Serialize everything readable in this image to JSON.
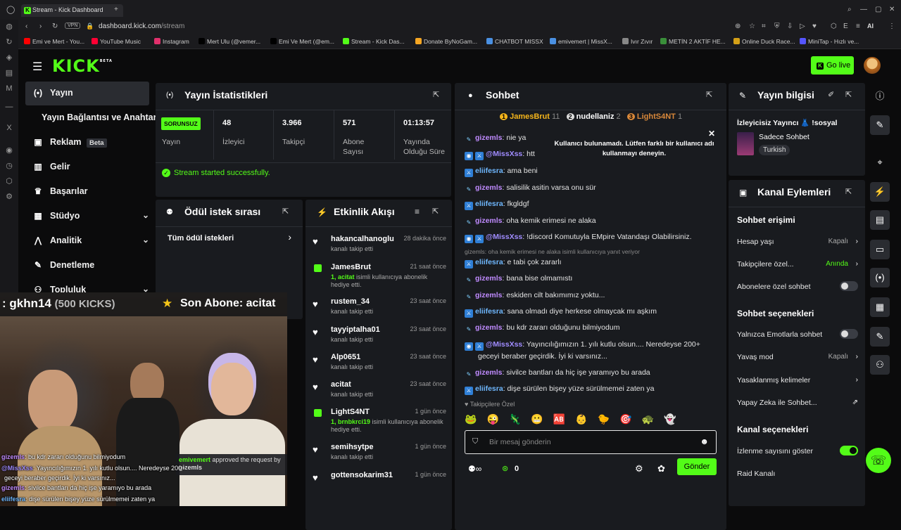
{
  "browser": {
    "tab_title": "Stream - Kick Dashboard",
    "url_domain": "dashboard.kick.com",
    "url_path": "/stream",
    "vpn_label": "VPN",
    "ai_label": "AI",
    "bookmarks": [
      {
        "label": "Emi ve Mert - You...",
        "color": "#ff0000"
      },
      {
        "label": "YouTube Music",
        "color": "#ff0033"
      },
      {
        "label": "Instagram",
        "color": "#e1306c"
      },
      {
        "label": "Mert Ulu (@vemer...",
        "color": "#000000"
      },
      {
        "label": "Emi Ve Mert (@em...",
        "color": "#000000"
      },
      {
        "label": "Stream - Kick Das...",
        "color": "#53fc18"
      },
      {
        "label": "Donate ByNoGam...",
        "color": "#f5a623"
      },
      {
        "label": "CHATBOT MISSX",
        "color": "#4a90e2"
      },
      {
        "label": "emivemert | MissX...",
        "color": "#4a90e2"
      },
      {
        "label": "Ivır Zıvır",
        "color": "#888888"
      },
      {
        "label": "METİN 2 AKTİF HE...",
        "color": "#3a8f3a"
      },
      {
        "label": "Online Duck Race...",
        "color": "#d4a017"
      },
      {
        "label": "MiniTap - Hızlı ve...",
        "color": "#5555ff"
      }
    ]
  },
  "kick": {
    "logo_text": "KICK",
    "logo_beta": "BETA",
    "go_live_label": "Go live",
    "brand_color": "#53fc18"
  },
  "sidebar": {
    "items": [
      {
        "label": "Yayın",
        "icon": "stream-icon"
      },
      {
        "label": "Yayın Bağlantısı ve Anahtarı",
        "icon": ""
      },
      {
        "label": "Reklam",
        "badge": "Beta",
        "icon": "ads-icon"
      },
      {
        "label": "Gelir",
        "icon": "revenue-icon"
      },
      {
        "label": "Başarılar",
        "icon": "trophy-icon"
      },
      {
        "label": "Stüdyo",
        "icon": "studio-icon"
      },
      {
        "label": "Analitik",
        "icon": "analytics-icon"
      },
      {
        "label": "Denetleme",
        "icon": "wrench-icon"
      },
      {
        "label": "Topluluk",
        "icon": "community-icon"
      }
    ]
  },
  "stats": {
    "title": "Yayın İstatistikleri",
    "status_badge": "SORUNSUZ",
    "status_label": "Yayın",
    "viewers_value": "48",
    "viewers_label": "İzleyici",
    "followers_value": "3.966",
    "followers_label": "Takipçi",
    "subs_value": "571",
    "subs_label_1": "Abone",
    "subs_label_2": "Sayısı",
    "uptime_value": "01:13:57",
    "uptime_label_1": "Yayında",
    "uptime_label_2": "Olduğu Süre",
    "success_msg": "Stream started successfully."
  },
  "rewards": {
    "title": "Ödül istek sırası",
    "all_requests": "Tüm ödül istekleri"
  },
  "activity": {
    "title": "Etkinlik Akışı",
    "events": [
      {
        "name": "hakancalhanoglu",
        "time": "28 dakika önce",
        "desc": "kanalı takip etti",
        "type": "follow"
      },
      {
        "name": "JamesBrut",
        "time": "21 saat önce",
        "desc_highlight": "1, acitat",
        "desc": "isimli kullanıcıya abonelik hediye etti.",
        "type": "gift"
      },
      {
        "name": "rustem_34",
        "time": "23 saat önce",
        "desc": "kanalı takip etti",
        "type": "follow"
      },
      {
        "name": "tayyiptalha01",
        "time": "23 saat önce",
        "desc": "kanalı takip etti",
        "type": "follow"
      },
      {
        "name": "Alp0651",
        "time": "23 saat önce",
        "desc": "kanalı takip etti",
        "type": "follow"
      },
      {
        "name": "acitat",
        "time": "23 saat önce",
        "desc": "kanalı takip etti",
        "type": "follow"
      },
      {
        "name": "LightS4NT",
        "time": "1 gün önce",
        "desc_highlight": "1, brnbkrci19",
        "desc": "isimli kullanıcıya abonelik hediye etti.",
        "type": "gift"
      },
      {
        "name": "semihsytpe",
        "time": "1 gün önce",
        "desc": "kanalı takip etti",
        "type": "follow"
      },
      {
        "name": "gottensokarim31",
        "time": "1 gün önce",
        "desc": "",
        "type": "follow"
      }
    ]
  },
  "chat": {
    "title": "Sohbet",
    "leaders": [
      {
        "rank": "1",
        "name": "JamesBrut",
        "count": "11"
      },
      {
        "rank": "2",
        "name": "nudellaniz",
        "count": "2"
      },
      {
        "rank": "3",
        "name": "LightS4NT",
        "count": "1"
      }
    ],
    "toast": "Kullanıcı bulunamadı. Lütfen farklı bir kullanıcı adı kullanmayı deneyin.",
    "reply_hint": "gizemls: oha kemik erimesi ne alaka isimli kullanıcıya yanıt veriyor",
    "messages": [
      {
        "user": "gizemls",
        "text": "nie ya"
      },
      {
        "user": "@MissXss",
        "text": "htt"
      },
      {
        "user": "eliifesra",
        "text": "ama beni"
      },
      {
        "user": "gizemls",
        "text": "salisilik asitin varsa onu sür"
      },
      {
        "user": "eliifesra",
        "text": "fkgldgf"
      },
      {
        "user": "gizemls",
        "text": "oha kemik erimesi ne alaka"
      },
      {
        "user": "@MissXss",
        "text": "!discord Komutuyla EMpire Vatandaşı Olabilirsiniz."
      },
      {
        "user": "eliifesra",
        "text": "e tabi çok zararlı"
      },
      {
        "user": "gizemls",
        "text": "bana bise olmamıstı"
      },
      {
        "user": "gizemls",
        "text": "eskiden cilt bakımımız yoktu..."
      },
      {
        "user": "eliifesra",
        "text": "sana olmadı diye herkese olmaycak mı aşkım"
      },
      {
        "user": "gizemls",
        "text": "bu kdr zararı olduğunu bilmiyodum"
      },
      {
        "user": "@MissXss",
        "text": "Yayıncılığımızın 1. yılı kutlu olsun.... Neredeyse 200+"
      },
      {
        "user": "",
        "text": "geceyi beraber geçirdik. İyi ki varsınız..."
      },
      {
        "user": "gizemls",
        "text": "sivilce bantları da hiç işe yaramıyo bu arada"
      },
      {
        "user": "eliifesra",
        "text": "dişe sürülen bişey yüze sürülmemei zaten ya"
      }
    ],
    "followers_only": "Takipçilere Özel",
    "input_placeholder": "Bir mesaj gönderin",
    "points": "0",
    "send_label": "Gönder"
  },
  "stream_info": {
    "title": "Yayın bilgisi",
    "stream_title": "İzleyicisiz Yayıncı 👗 !sosyal",
    "category": "Sadece Sohbet",
    "language": "Turkish"
  },
  "channel_actions": {
    "title": "Kanal Eylemleri",
    "chat_access_title": "Sohbet erişimi",
    "account_age": "Hesap yaşı",
    "account_age_value": "Kapalı",
    "followers_only": "Takipçilere özel...",
    "followers_only_value": "Anında",
    "subs_only": "Abonelere özel sohbet",
    "chat_options_title": "Sohbet seçenekleri",
    "emote_only": "Yalnızca Emotlarla sohbet",
    "slow_mode": "Yavaş mod",
    "slow_mode_value": "Kapalı",
    "banned_words": "Yasaklanmış kelimeler",
    "ai_chat": "Yapay Zeka ile Sohbet...",
    "channel_options_title": "Kanal seçenekleri",
    "show_views": "İzlenme sayısını göster",
    "raid_channel": "Raid Kanalı"
  },
  "overlay": {
    "banner_left": ": gkhn14",
    "banner_left_sub": "(500 KICKS)",
    "banner_right": "Son Abone: acitat",
    "approve_user": "emivemert",
    "approve_text": "approved the request by",
    "approve_user2": "gizemls",
    "chat": [
      {
        "user": "gizemls",
        "text": "bu kdr zararı olduğunu bilmiyodum"
      },
      {
        "user": "@MissXss",
        "text": "Yayıncılığımızın 1. yılı kutlu olsun.... Neredeyse 200+"
      },
      {
        "user": "",
        "text": "geceyi beraber geçirdik. İyi ki varsınız..."
      },
      {
        "user": "gizemls",
        "text": "sivilce bantları da hiç işe yaramıyo bu arada"
      },
      {
        "user": "eliifesra",
        "text": "dişe sürülen bişey yüze sürülmemei zaten ya"
      }
    ]
  }
}
